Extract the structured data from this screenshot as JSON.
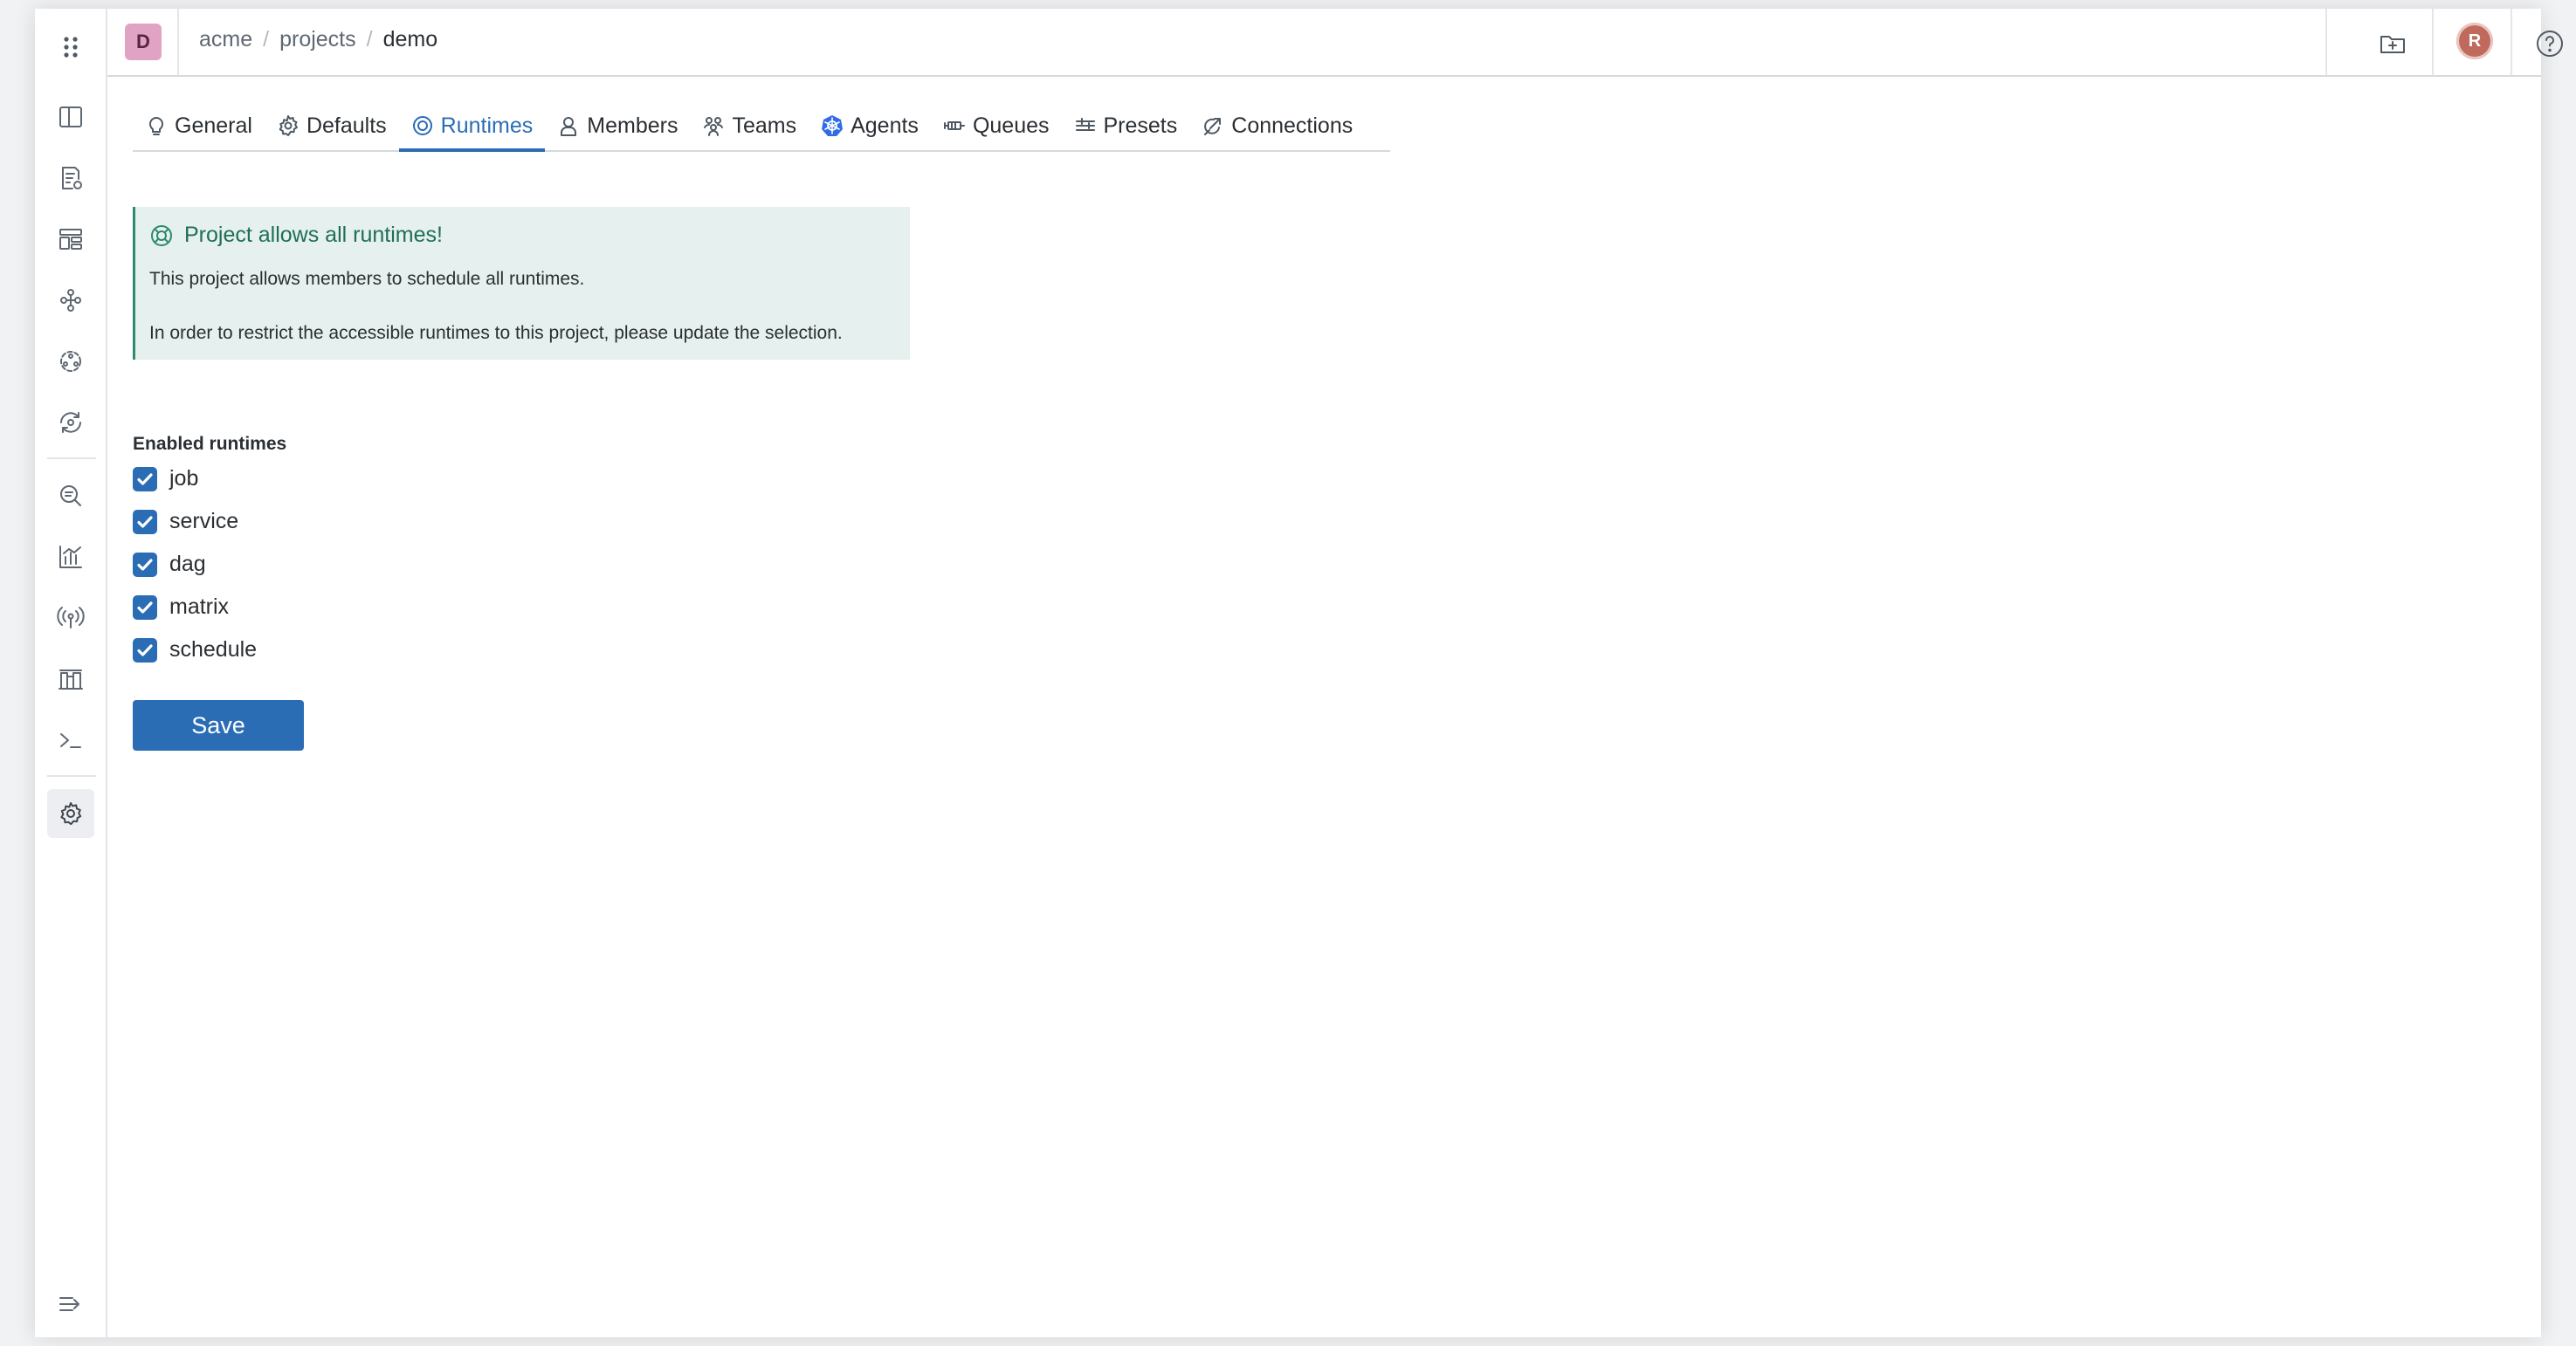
{
  "header": {
    "project_initial": "D",
    "breadcrumbs": [
      {
        "label": "acme"
      },
      {
        "label": "projects"
      },
      {
        "label": "demo"
      }
    ],
    "user_initial": "R"
  },
  "sidebar": {
    "icons": [
      "layout-panel-icon",
      "runs-list-icon",
      "dashboard-icon",
      "flow-icon",
      "components-icon",
      "eye-icon",
      "search-analytics-icon",
      "chart-icon",
      "broadcast-icon",
      "building-icon",
      "terminal-icon",
      "settings-icon",
      "expand-sidebar-icon"
    ]
  },
  "tabs": [
    {
      "label": "General",
      "icon": "lightbulb-icon",
      "active": false
    },
    {
      "label": "Defaults",
      "icon": "gear-icon",
      "active": false
    },
    {
      "label": "Runtimes",
      "icon": "target-icon",
      "active": true
    },
    {
      "label": "Members",
      "icon": "person-icon",
      "active": false
    },
    {
      "label": "Teams",
      "icon": "team-icon",
      "active": false
    },
    {
      "label": "Agents",
      "icon": "kubernetes-icon",
      "active": false
    },
    {
      "label": "Queues",
      "icon": "queue-icon",
      "active": false
    },
    {
      "label": "Presets",
      "icon": "presets-icon",
      "active": false
    },
    {
      "label": "Connections",
      "icon": "connection-icon",
      "active": false
    }
  ],
  "callout": {
    "title": "Project allows all runtimes!",
    "line1": "This project allows members to schedule all runtimes.",
    "line2": "In order to restrict the accessible runtimes to this project, please update the selection."
  },
  "runtimes": {
    "label": "Enabled runtimes",
    "options": [
      {
        "label": "job",
        "checked": true
      },
      {
        "label": "service",
        "checked": true
      },
      {
        "label": "dag",
        "checked": true
      },
      {
        "label": "matrix",
        "checked": true
      },
      {
        "label": "schedule",
        "checked": true
      }
    ]
  },
  "actions": {
    "save_label": "Save"
  },
  "colors": {
    "accent": "#2a6db5",
    "callout_bg": "#e6f0ee",
    "callout_border": "#2e8a6d",
    "project_badge": "#e1a3c4",
    "avatar": "#c06a5e"
  }
}
